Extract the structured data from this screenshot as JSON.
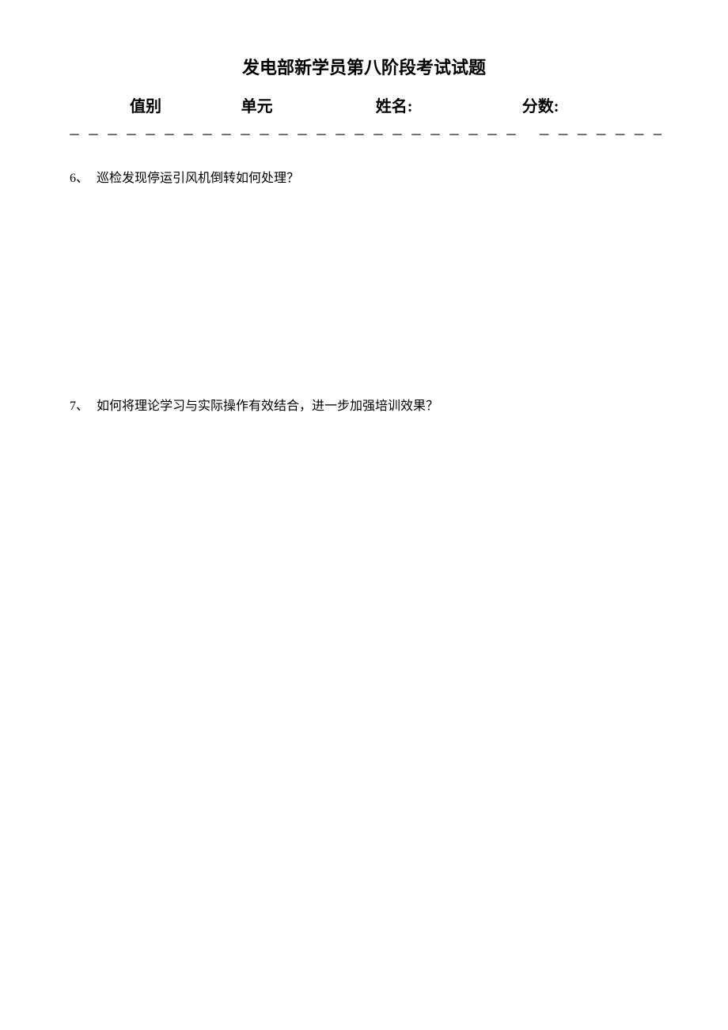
{
  "title": "发电部新学员第八阶段考试试题",
  "header": {
    "zhibie": "值别",
    "danyuan": "单元",
    "xingming": "姓名:",
    "fenshu": "分数:"
  },
  "divider": "－－－－－－－－－－－－－－－－－－－－－－－－ －－－－－－－－－－－－－－ －－－",
  "questions": {
    "q6": {
      "number": "6、",
      "text": "巡检发现停运引风机倒转如何处理？"
    },
    "q7": {
      "number": "7、",
      "text": "如何将理论学习与实际操作有效结合，进一步加强培训效果？"
    }
  }
}
